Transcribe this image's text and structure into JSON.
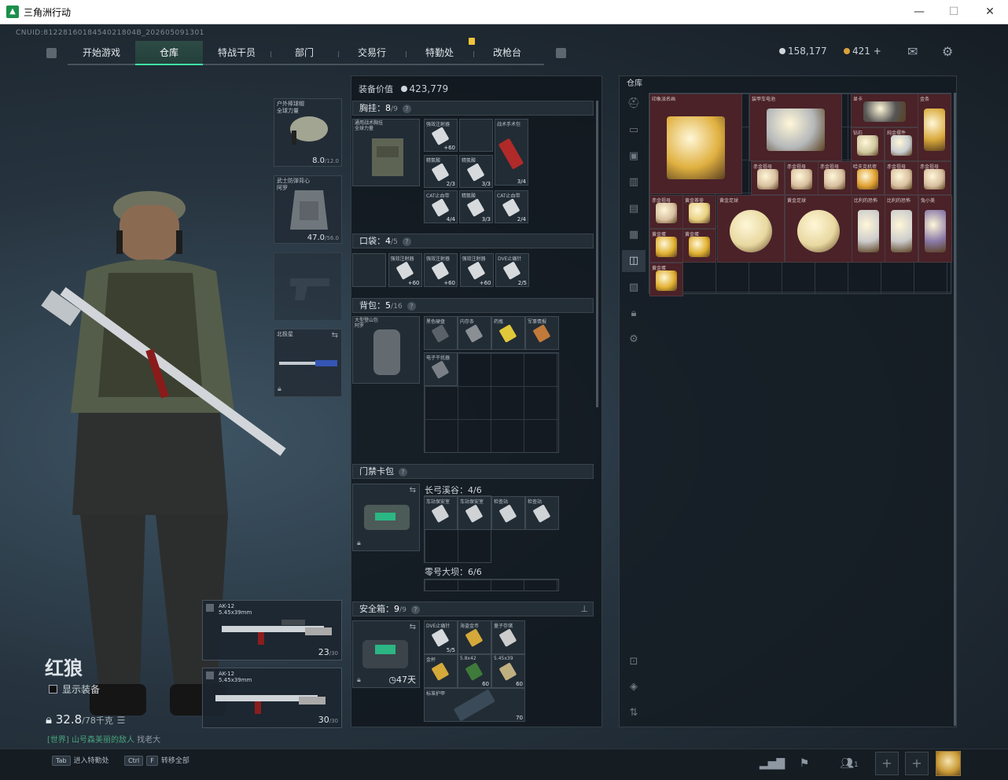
{
  "window": {
    "title": "三角洲行动",
    "minimize": "—",
    "maximize": "☐",
    "close": "✕"
  },
  "uid": "CNUID:8122816018454021804B_202605091301",
  "nav": {
    "tabs": [
      "开始游戏",
      "仓库",
      "特战干员",
      "部门",
      "交易行",
      "特勤处",
      "改枪台"
    ],
    "active": "仓库"
  },
  "currency": {
    "silver": "158,177",
    "gold": "421",
    "plus": "+"
  },
  "operator": {
    "name": "红狼",
    "show_equipment": "显示装备",
    "weight": "32.8",
    "weight_max": "/78千克",
    "chat_channel": "[世界] 山号森美丽的敌人",
    "chat_tail": " 找老大"
  },
  "gear": {
    "helmet": {
      "label": "户外棒球帽\n全球力量",
      "value": "8.0",
      "max": "/12.0"
    },
    "armor": {
      "label": "武士防弹背心\n阿罗",
      "value": "47.0",
      "max": "/56.0"
    },
    "melee": {
      "label": "北极星"
    }
  },
  "weapons": [
    {
      "name": "AK-12",
      "caliber": "5.45x39mm",
      "ammo": "23",
      "max": "/30"
    },
    {
      "name": "AK-12",
      "caliber": "5.45x39mm",
      "ammo": "30",
      "max": "/30"
    }
  ],
  "equipment": {
    "value_label": "装备价值",
    "value": "423,779",
    "chest": {
      "title": "胸挂：",
      "count": "8",
      "max": "/9",
      "item": "通用战术胸挂\n全球力量",
      "cells": [
        {
          "l": "强效注射器",
          "c": "+60"
        },
        {
          "l": "",
          "c": ""
        },
        {
          "l": "战术手术包",
          "c": "3/4"
        },
        {
          "l": "精氨酸",
          "c": "2/3"
        },
        {
          "l": "精氨酸",
          "c": "3/3"
        },
        {
          "l": "CAT止血带",
          "c": "4/4"
        },
        {
          "l": "精氨酸",
          "c": "3/3"
        },
        {
          "l": "CAT止血带",
          "c": "2/4"
        }
      ]
    },
    "pocket": {
      "title": "口袋：",
      "count": "4",
      "max": "/5",
      "cells": [
        {
          "l": "",
          "c": ""
        },
        {
          "l": "强效注射器",
          "c": "+60"
        },
        {
          "l": "强效注射器",
          "c": "+60"
        },
        {
          "l": "强效注射器",
          "c": "+60"
        },
        {
          "l": "DVE止痛针",
          "c": "2/5"
        }
      ]
    },
    "backpack": {
      "title": "背包：",
      "count": "5",
      "max": "/16",
      "item": "大型登山包\n阿罗",
      "cells": [
        {
          "l": "黑色硬盘"
        },
        {
          "l": "内存条"
        },
        {
          "l": "药瓶"
        },
        {
          "l": "军事情报"
        },
        {
          "l": "电子干扰器"
        }
      ]
    },
    "keycard": {
      "title": "门禁卡包",
      "area1": "长弓溪谷：4/6",
      "area2": "零号大坝：6/6",
      "cards": [
        "车站保安室",
        "车站保安室",
        "检查站",
        "检查站"
      ]
    },
    "safe": {
      "title": "安全箱：",
      "count": "9",
      "max": "/9",
      "timer": "47天",
      "cells": [
        {
          "l": "DVE止痛针",
          "c": "5/5"
        },
        {
          "l": "海盗金币",
          "c": ""
        },
        {
          "l": "量子存储",
          "c": ""
        },
        {
          "l": "金杯",
          "c": ""
        },
        {
          "l": "5.8x42",
          "c": "60"
        },
        {
          "l": "5.45x39",
          "c": "60"
        },
        {
          "l": "标准护甲",
          "c": "70"
        }
      ]
    }
  },
  "stash": {
    "title": "仓库",
    "items": [
      "印象派名画",
      "装甲车电池",
      "显卡",
      "金条",
      "纯金摆件",
      "钻石",
      "哈夫克机密",
      "赤金祖母",
      "赤金祖母",
      "赤金祖母",
      "赤金祖母",
      "赤金祖母",
      "赤金祖母",
      "黄金茶壶",
      "黄金足球",
      "黄金足球",
      "比利的恐怖",
      "比利的恐怖",
      "兔小美",
      "黄金蛋",
      "黄金蛋",
      "黄金蛋"
    ]
  },
  "bottom": {
    "hint1_key": "Tab",
    "hint1": "进入特勤处",
    "hint2_key1": "Ctrl",
    "hint2_key2": "F",
    "hint2": "转移全部",
    "friends": "1"
  }
}
